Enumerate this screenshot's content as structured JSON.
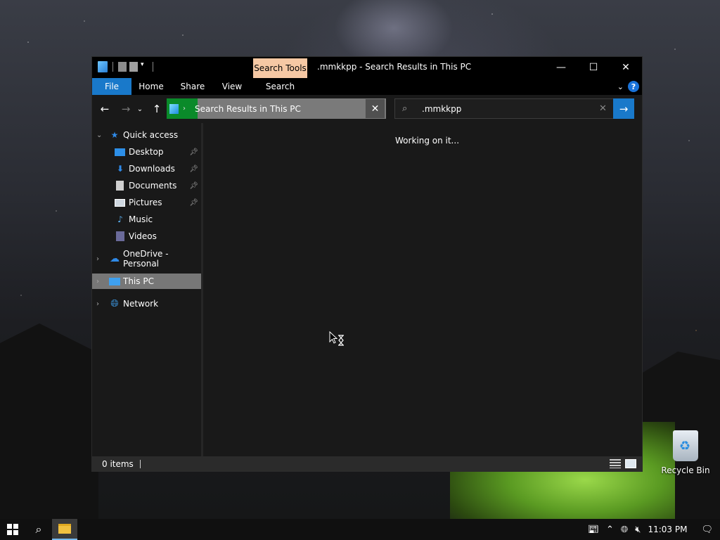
{
  "window": {
    "title": ".mmkkpp - Search Results in This PC",
    "context_tab": "Search Tools",
    "ribbon_tabs": [
      "File",
      "Home",
      "Share",
      "View",
      "Search"
    ],
    "help": "?"
  },
  "address_bar": {
    "path": "Search Results in This PC"
  },
  "search": {
    "query": ".mmkkpp"
  },
  "sidebar": {
    "quick_access": "Quick access",
    "items": [
      {
        "label": "Desktop",
        "icon": "desktop-icon",
        "pinned": true
      },
      {
        "label": "Downloads",
        "icon": "downloads-icon",
        "pinned": true
      },
      {
        "label": "Documents",
        "icon": "documents-icon",
        "pinned": true
      },
      {
        "label": "Pictures",
        "icon": "pictures-icon",
        "pinned": true
      },
      {
        "label": "Music",
        "icon": "music-icon",
        "pinned": false
      },
      {
        "label": "Videos",
        "icon": "videos-icon",
        "pinned": false
      }
    ],
    "onedrive": "OneDrive - Personal",
    "this_pc": "This PC",
    "network": "Network"
  },
  "content": {
    "status_message": "Working on it..."
  },
  "status_bar": {
    "item_count": "0 items"
  },
  "desktop": {
    "recycle_bin": "Recycle Bin"
  },
  "taskbar": {
    "clock": "11:03 PM"
  },
  "colors": {
    "accent": "#1979ca",
    "context_tab": "#f6c8a4",
    "selection": "#777777"
  }
}
